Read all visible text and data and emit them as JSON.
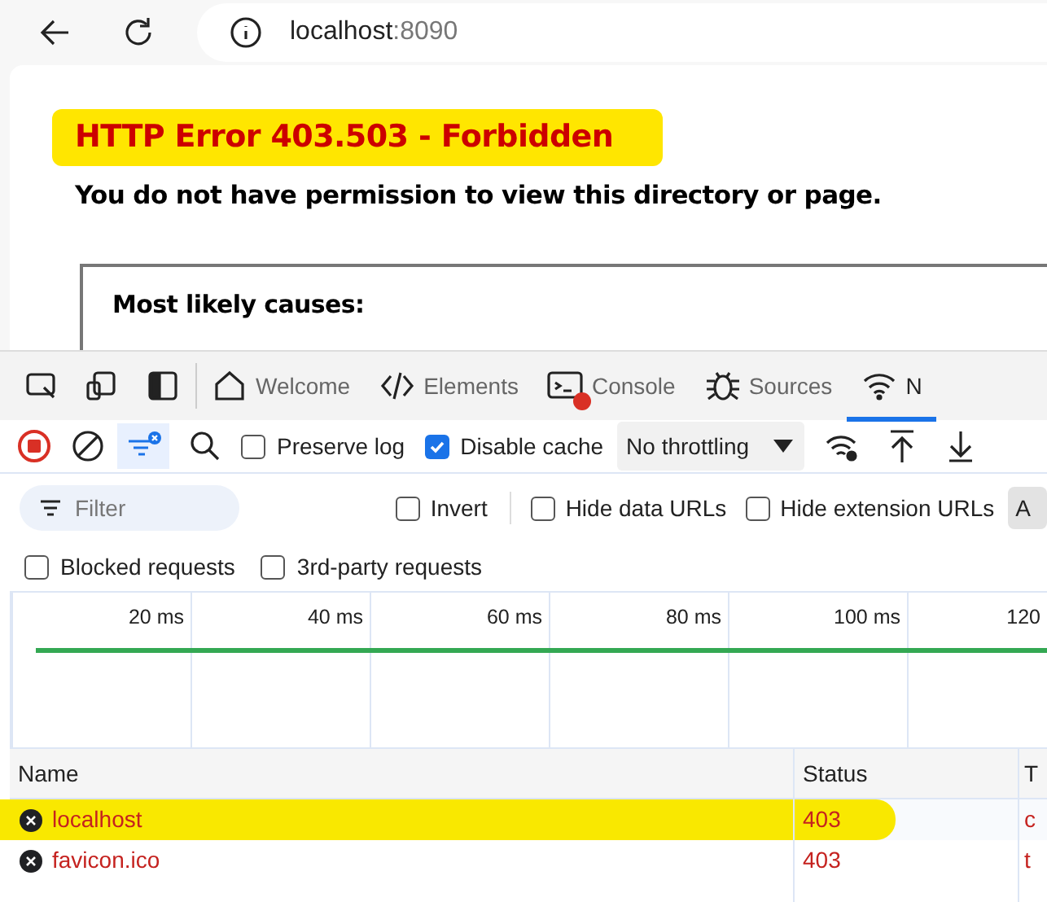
{
  "address_bar": {
    "host": "localhost",
    "port": ":8090"
  },
  "page": {
    "title": "HTTP Error 403.503 - Forbidden",
    "title_highlighted": true,
    "subtitle": "You do not have permission to view this directory or page.",
    "box_heading": "Most likely causes:"
  },
  "devtools": {
    "tabs": [
      {
        "label": "Welcome",
        "selected": false
      },
      {
        "label": "Elements",
        "selected": false
      },
      {
        "label": "Console",
        "selected": false,
        "error_badge": true
      },
      {
        "label": "Sources",
        "selected": false
      },
      {
        "label": "N",
        "selected": true
      }
    ],
    "toolbar": {
      "preserve_log": {
        "label": "Preserve log",
        "checked": false
      },
      "disable_cache": {
        "label": "Disable cache",
        "checked": true
      },
      "throttling": "No throttling"
    },
    "filter": {
      "placeholder": "Filter",
      "options": [
        {
          "label": "Invert",
          "checked": false
        },
        {
          "label": "Hide data URLs",
          "checked": false
        },
        {
          "label": "Hide extension URLs",
          "checked": false
        }
      ],
      "cut_button": "A"
    },
    "options_row": [
      {
        "label": "Blocked requests",
        "checked": false
      },
      {
        "label": "3rd-party requests",
        "checked": false
      }
    ],
    "timeline_ticks": [
      "20 ms",
      "40 ms",
      "60 ms",
      "80 ms",
      "100 ms",
      "120"
    ],
    "table": {
      "columns": [
        "Name",
        "Status",
        "T"
      ],
      "rows": [
        {
          "name": "localhost",
          "status": "403",
          "column_3": "c",
          "highlighted": true
        },
        {
          "name": "favicon.ico",
          "status": "403",
          "column_3": "t",
          "highlighted": false
        }
      ]
    }
  }
}
